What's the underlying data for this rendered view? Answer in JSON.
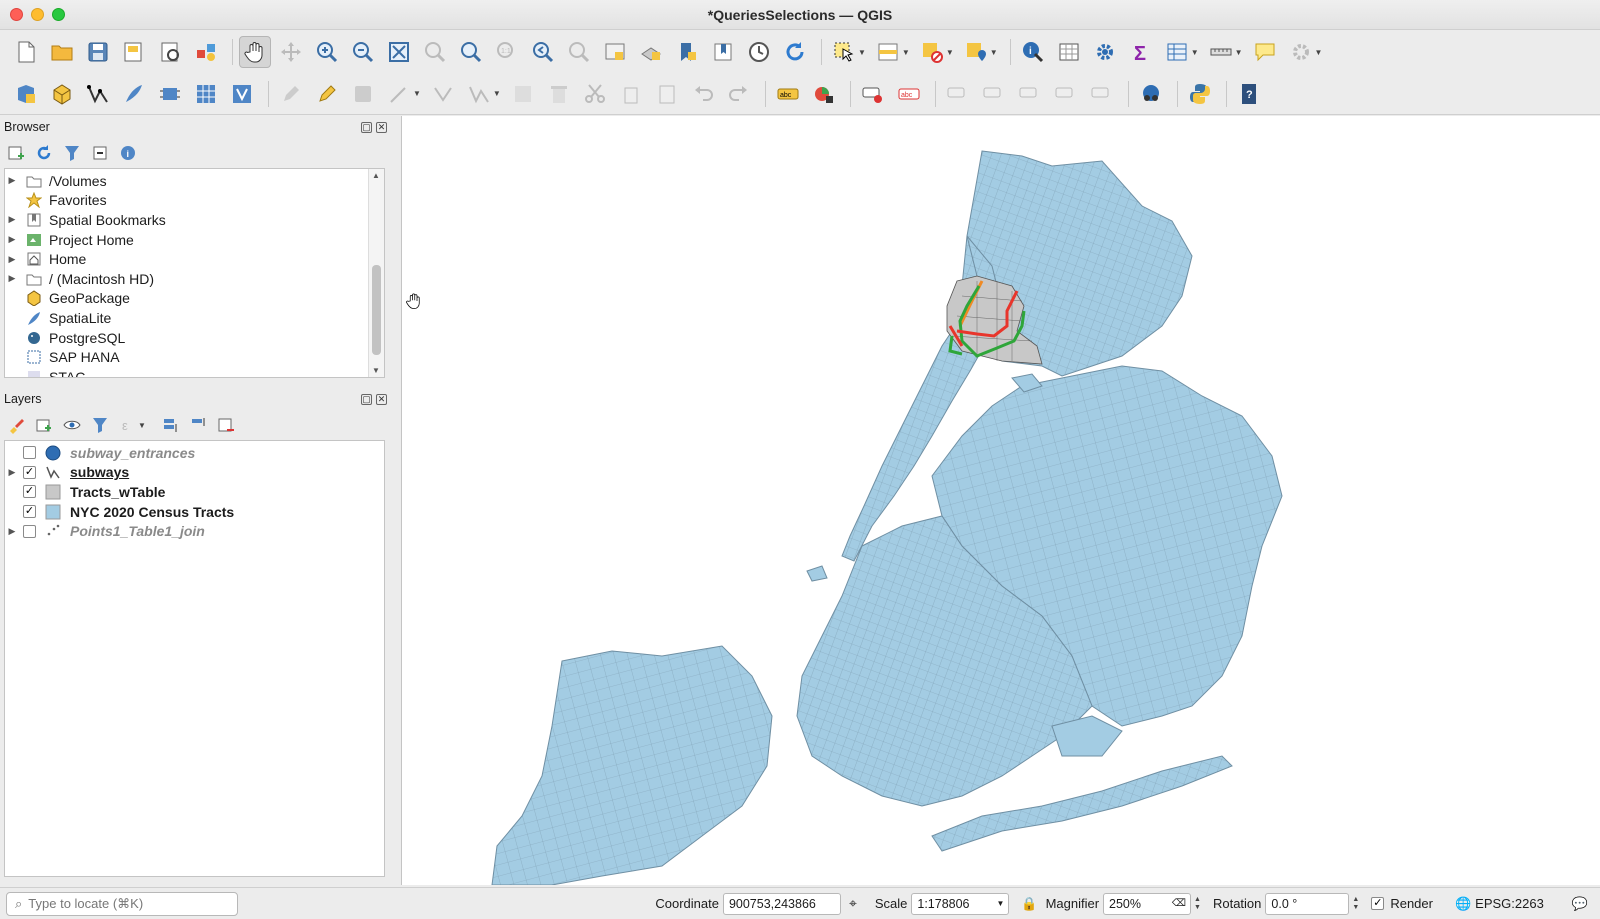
{
  "window": {
    "title": "*QueriesSelections — QGIS"
  },
  "browser": {
    "title": "Browser",
    "items": [
      {
        "label": "/Volumes",
        "icon": "folder-icon",
        "expandable": true
      },
      {
        "label": "Favorites",
        "icon": "star-icon",
        "expandable": false
      },
      {
        "label": "Spatial Bookmarks",
        "icon": "bookmark-icon",
        "expandable": true
      },
      {
        "label": "Project Home",
        "icon": "project-home-icon",
        "expandable": true
      },
      {
        "label": "Home",
        "icon": "home-icon",
        "expandable": true
      },
      {
        "label": "/ (Macintosh HD)",
        "icon": "folder-icon",
        "expandable": true
      },
      {
        "label": "GeoPackage",
        "icon": "geopackage-icon",
        "expandable": false
      },
      {
        "label": "SpatiaLite",
        "icon": "spatialite-icon",
        "expandable": false
      },
      {
        "label": "PostgreSQL",
        "icon": "postgresql-icon",
        "expandable": false
      },
      {
        "label": "SAP HANA",
        "icon": "sap-hana-icon",
        "expandable": false
      },
      {
        "label": "STAC",
        "icon": "stac-icon",
        "expandable": false
      }
    ]
  },
  "layers": {
    "title": "Layers",
    "items": [
      {
        "label": "subway_entrances",
        "checked": false,
        "symbol": "point",
        "color": "#2e6db3",
        "visible": false,
        "expandable": false
      },
      {
        "label": "subways",
        "checked": true,
        "symbol": "line",
        "color": "#555555",
        "visible": true,
        "expandable": true,
        "underline": true
      },
      {
        "label": "Tracts_wTable",
        "checked": true,
        "symbol": "polygon",
        "color": "#c8c8c8",
        "visible": true,
        "expandable": false
      },
      {
        "label": "NYC 2020 Census Tracts",
        "checked": true,
        "symbol": "polygon",
        "color": "#a3cce3",
        "visible": true,
        "expandable": false
      },
      {
        "label": "Points1_Table1_join",
        "checked": false,
        "symbol": "points",
        "color": "#666666",
        "visible": false,
        "expandable": true
      }
    ]
  },
  "status": {
    "locate_placeholder": "Type to locate (⌘K)",
    "coordinate_label": "Coordinate",
    "coordinate_value": "900753,243866",
    "scale_label": "Scale",
    "scale_value": "1:178806",
    "magnifier_label": "Magnifier",
    "magnifier_value": "250%",
    "rotation_label": "Rotation",
    "rotation_value": "0.0 °",
    "render_label": "Render",
    "render_checked": true,
    "crs": "EPSG:2263"
  },
  "map": {
    "land_color": "#a3cce3",
    "selected_color": "#c8c8c8",
    "boundary_color": "#6f8fa3",
    "subway_colors": [
      "#e8352b",
      "#2fa63a",
      "#f08a24"
    ]
  }
}
